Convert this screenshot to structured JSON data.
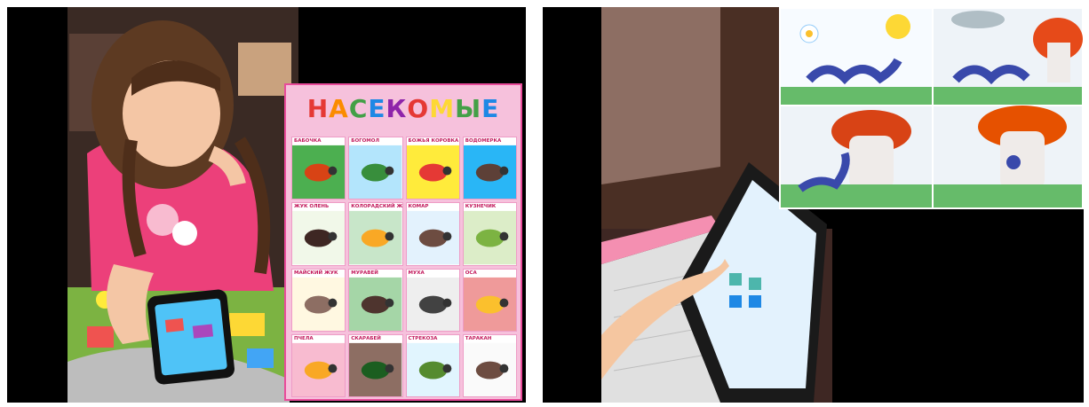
{
  "poster": {
    "title_letters": [
      "Н",
      "А",
      "С",
      "Е",
      "К",
      "О",
      "М",
      "Ы",
      "Е"
    ],
    "title_colors": [
      "#e53935",
      "#fb8c00",
      "#43a047",
      "#1e88e5",
      "#8e24aa",
      "#e53935",
      "#fdd835",
      "#43a047",
      "#1e88e5"
    ],
    "cells": [
      {
        "label": "БАБОЧКА",
        "icon": "butterfly-icon",
        "bg": "#4caf50",
        "color": "#d84315"
      },
      {
        "label": "БОГОМОЛ",
        "icon": "mantis-icon",
        "bg": "#b3e5fc",
        "color": "#388e3c"
      },
      {
        "label": "БОЖЬЯ КОРОВКА",
        "icon": "ladybug-icon",
        "bg": "#ffeb3b",
        "color": "#e53935"
      },
      {
        "label": "ВОДОМЕРКА",
        "icon": "water-strider-icon",
        "bg": "#29b6f6",
        "color": "#5d4037"
      },
      {
        "label": "ЖУК ОЛЕНЬ",
        "icon": "stag-beetle-icon",
        "bg": "#f1f8e9",
        "color": "#3e2723"
      },
      {
        "label": "КОЛОРАДСКИЙ ЖУК",
        "icon": "colorado-beetle-icon",
        "bg": "#c8e6c9",
        "color": "#f9a825"
      },
      {
        "label": "КОМАР",
        "icon": "mosquito-icon",
        "bg": "#e3f2fd",
        "color": "#6d4c41"
      },
      {
        "label": "КУЗНЕЧИК",
        "icon": "grasshopper-icon",
        "bg": "#dcedc8",
        "color": "#7cb342"
      },
      {
        "label": "МАЙСКИЙ ЖУК",
        "icon": "cockchafer-icon",
        "bg": "#fff8e1",
        "color": "#8d6e63"
      },
      {
        "label": "МУРАВЕЙ",
        "icon": "ant-icon",
        "bg": "#a5d6a7",
        "color": "#4e342e"
      },
      {
        "label": "МУХА",
        "icon": "fly-icon",
        "bg": "#eeeeee",
        "color": "#424242"
      },
      {
        "label": "ОСА",
        "icon": "wasp-icon",
        "bg": "#ef9a9a",
        "color": "#fbc02d"
      },
      {
        "label": "ПЧЕЛА",
        "icon": "bee-icon",
        "bg": "#f8bbd0",
        "color": "#f9a825"
      },
      {
        "label": "СКАРАБЕЙ",
        "icon": "scarab-icon",
        "bg": "#8d6e63",
        "color": "#1b5e20"
      },
      {
        "label": "СТРЕКОЗА",
        "icon": "dragonfly-icon",
        "bg": "#e1f5fe",
        "color": "#558b2f"
      },
      {
        "label": "ТАРАКАН",
        "icon": "cockroach-icon",
        "bg": "#fafafa",
        "color": "#6d4c41"
      }
    ]
  },
  "scenes": {
    "left": {
      "subject": "girl-icon",
      "device": "smartphone-icon",
      "mat": "play-mat-icon"
    },
    "right": {
      "device": "tablet-icon",
      "laptop": "laptop-icon",
      "cards": [
        "caterpillar-sunflower-card",
        "caterpillar-rain-card",
        "caterpillar-mushroom-card",
        "caterpillar-mushroom-rain-card"
      ]
    }
  }
}
